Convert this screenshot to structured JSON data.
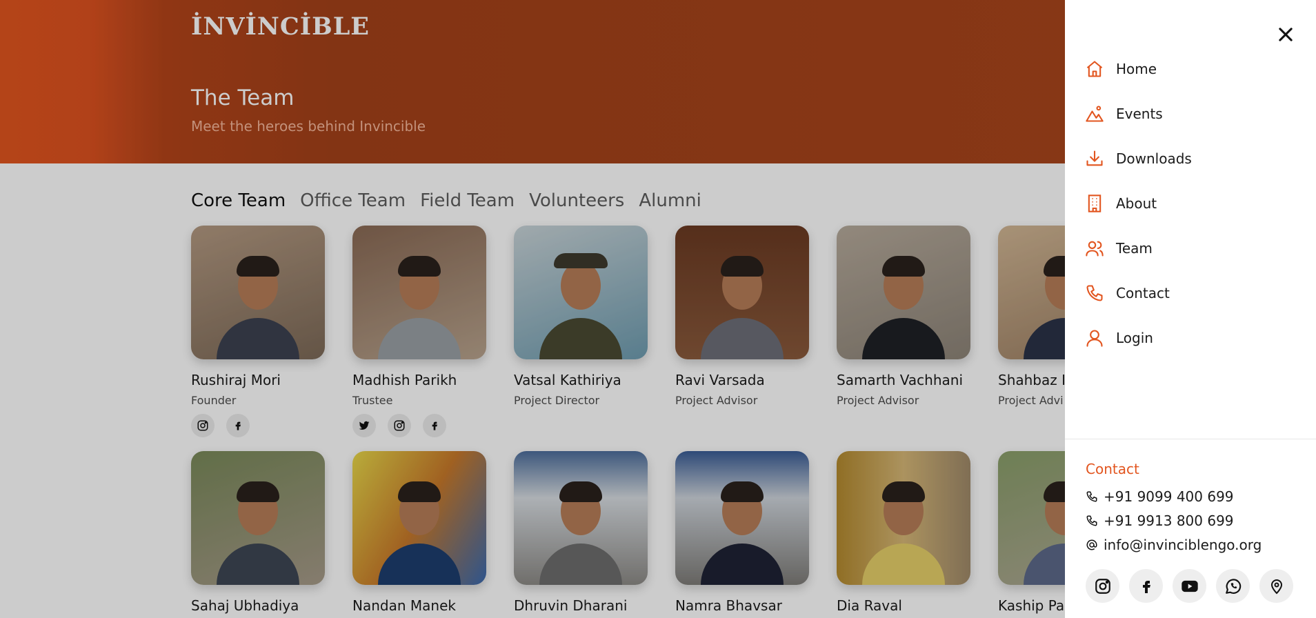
{
  "brand": {
    "logo_text": "İNVİNCİBLE"
  },
  "hero": {
    "title": "The Team",
    "subtitle": "Meet the heroes behind Invincible"
  },
  "tabs": [
    {
      "label": "Core Team",
      "active": true
    },
    {
      "label": "Office Team",
      "active": false
    },
    {
      "label": "Field Team",
      "active": false
    },
    {
      "label": "Volunteers",
      "active": false
    },
    {
      "label": "Alumni",
      "active": false
    }
  ],
  "team_row1": [
    {
      "name": "Rushiraj Mori",
      "role": "Founder",
      "socials": [
        "instagram-icon",
        "facebook-icon"
      ]
    },
    {
      "name": "Madhish Parikh",
      "role": "Trustee",
      "socials": [
        "twitter-icon",
        "instagram-icon",
        "facebook-icon"
      ]
    },
    {
      "name": "Vatsal Kathiriya",
      "role": "Project Director",
      "socials": []
    },
    {
      "name": "Ravi Varsada",
      "role": "Project Advisor",
      "socials": []
    },
    {
      "name": "Samarth Vachhani",
      "role": "Project Advisor",
      "socials": []
    },
    {
      "name": "Shahbaz I",
      "role": "Project Advi",
      "socials": []
    }
  ],
  "team_row2": [
    {
      "name": "Sahaj Ubhadiya"
    },
    {
      "name": "Nandan Manek"
    },
    {
      "name": "Dhruvin Dharani"
    },
    {
      "name": "Namra Bhavsar"
    },
    {
      "name": "Dia Raval"
    },
    {
      "name": "Kaship Pa"
    }
  ],
  "drawer": {
    "menu": [
      {
        "label": "Home",
        "icon": "home-icon"
      },
      {
        "label": "Events",
        "icon": "mountain-icon"
      },
      {
        "label": "Downloads",
        "icon": "download-icon"
      },
      {
        "label": "About",
        "icon": "building-icon"
      },
      {
        "label": "Team",
        "icon": "users-icon"
      },
      {
        "label": "Contact",
        "icon": "phone-icon"
      },
      {
        "label": "Login",
        "icon": "user-icon"
      }
    ],
    "contact": {
      "heading": "Contact",
      "phone1": "+91 9099 400 699",
      "phone2": "+91 9913 800 699",
      "email": "info@invinciblengo.org"
    },
    "socials": [
      "instagram-icon",
      "facebook-icon",
      "youtube-icon",
      "whatsapp-icon",
      "location-pin-icon"
    ]
  },
  "colors": {
    "accent": "#e2551f",
    "hero": "#a4421a",
    "text": "#1b1b1b"
  }
}
